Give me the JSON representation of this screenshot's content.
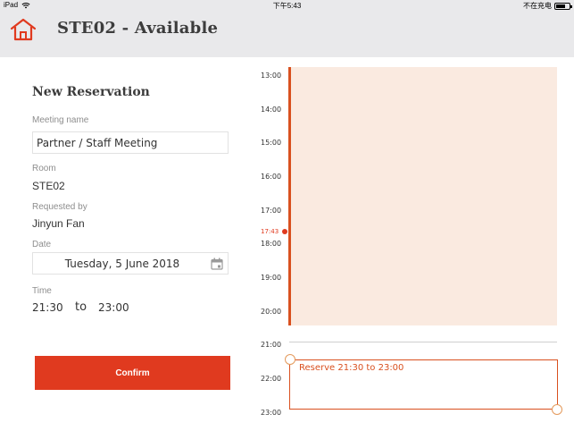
{
  "status_bar": {
    "device": "iPad",
    "time": "下午5:43",
    "charging": "不在充电"
  },
  "header": {
    "title": "STE02 - Available"
  },
  "form": {
    "heading": "New Reservation",
    "meeting_name_label": "Meeting name",
    "meeting_name_value": "Partner / Staff Meeting",
    "room_label": "Room",
    "room_value": "STE02",
    "requested_by_label": "Requested by",
    "requested_by_value": "Jinyun Fan",
    "date_label": "Date",
    "date_value": "Tuesday, 5 June 2018",
    "time_label": "Time",
    "time_start": "21:30",
    "time_separator": "to",
    "time_end": "23:00",
    "confirm_label": "Confirm"
  },
  "timeline": {
    "hours": [
      "13:00",
      "14:00",
      "15:00",
      "16:00",
      "17:00",
      "18:00",
      "19:00",
      "20:00",
      "21:00",
      "22:00",
      "23:00"
    ],
    "current_time": "17:43",
    "reservation_text": "Reserve 21:30 to 23:00"
  },
  "colors": {
    "accent": "#e03a1f",
    "booked_fill": "#faeae0",
    "header_bg": "#e9e9eb"
  }
}
